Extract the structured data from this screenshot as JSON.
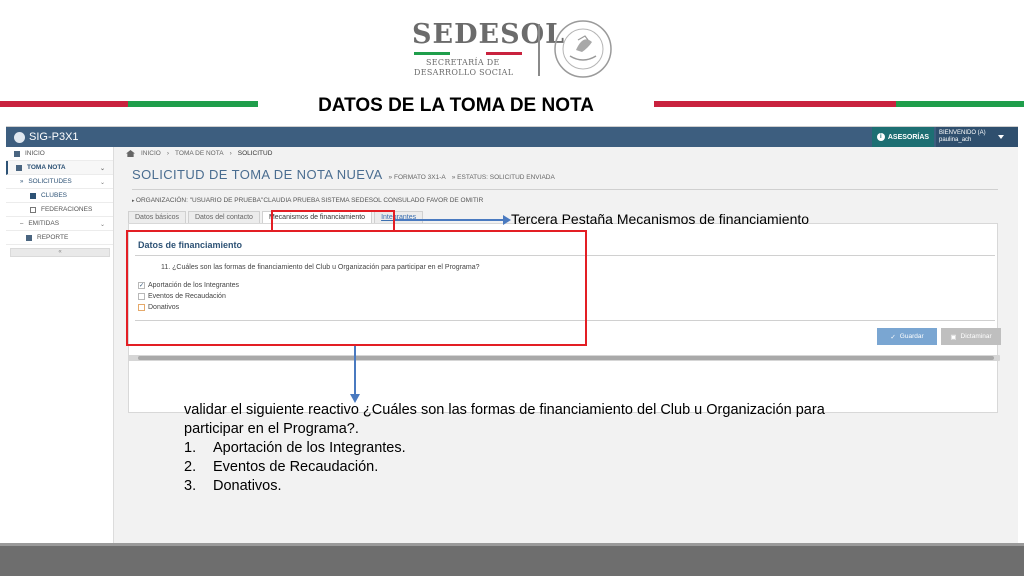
{
  "header": {
    "logo_title": "SEDESOL",
    "logo_sub_1": "SECRETARÍA DE",
    "logo_sub_2": "DESARROLLO SOCIAL",
    "seal_text": "ESTADOS UNIDOS MEXICANOS",
    "slide_title": "DATOS DE LA TOMA DE NOTA",
    "colors": {
      "green": "#1f9e4b",
      "red": "#c9223e",
      "grey": "#d9d9d9"
    }
  },
  "app": {
    "brand": "SIG-P3X1",
    "asesorias_label": "ASESORÍAS",
    "user_line_1": "BIENVENIDO (A)",
    "user_line_2": "paulina_ach",
    "sidebar": {
      "items": [
        {
          "label": "INICIO",
          "icon": "home-icon"
        },
        {
          "label": "TOMA NOTA",
          "icon": "file-icon"
        },
        {
          "label": "SOLICITUDES",
          "icon": "list-icon"
        },
        {
          "label": "CLUBES",
          "icon": "bookmark-icon"
        },
        {
          "label": "FEDERACIONES",
          "icon": "picture-icon"
        },
        {
          "label": "EMITIDAS",
          "icon": "list-icon"
        },
        {
          "label": "REPORTE",
          "icon": "report-icon"
        }
      ],
      "collapse": "«"
    },
    "breadcrumb": [
      "INICIO",
      "TOMA DE NOTA",
      "SOLICITUD"
    ],
    "heading": "SOLICITUD DE TOMA DE NOTA NUEVA",
    "heading_format": "» FORMATO 3X1-A",
    "heading_status": "» ESTATUS: SOLICITUD ENVIADA",
    "organization": "ORGANIZACIÓN: \"USUARIO DE PRUEBA\"CLAUDIA PRUEBA SISTEMA SEDESOL CONSULADO FAVOR DE OMITIR",
    "tabs": [
      "Datos básicos",
      "Datos del contacto",
      "Mecanismos de financiamiento",
      "Integrantes"
    ],
    "panel_title": "Datos de financiamiento",
    "question": "11. ¿Cuáles son las formas de financiamiento del Club u Organización para participar en el Programa?",
    "options": [
      {
        "label": "Aportación de los Integrantes",
        "checked": true
      },
      {
        "label": "Eventos de Recaudación",
        "checked": false
      },
      {
        "label": "Donativos",
        "checked": false
      }
    ],
    "save_label": "Guardar",
    "dictaminar_label": "Dictaminar"
  },
  "annotations": {
    "callout": "Tercera Pestaña Mecanismos de financiamiento",
    "note_line_1": "validar el siguiente reactivo ¿Cuáles son las formas de financiamiento del Club u Organización para",
    "note_line_2": "participar en el Programa?.",
    "list": [
      {
        "num": "1.",
        "text": "Aportación de los Integrantes."
      },
      {
        "num": "2.",
        "text": "Eventos de Recaudación."
      },
      {
        "num": "3.",
        "text": "Donativos."
      }
    ]
  }
}
